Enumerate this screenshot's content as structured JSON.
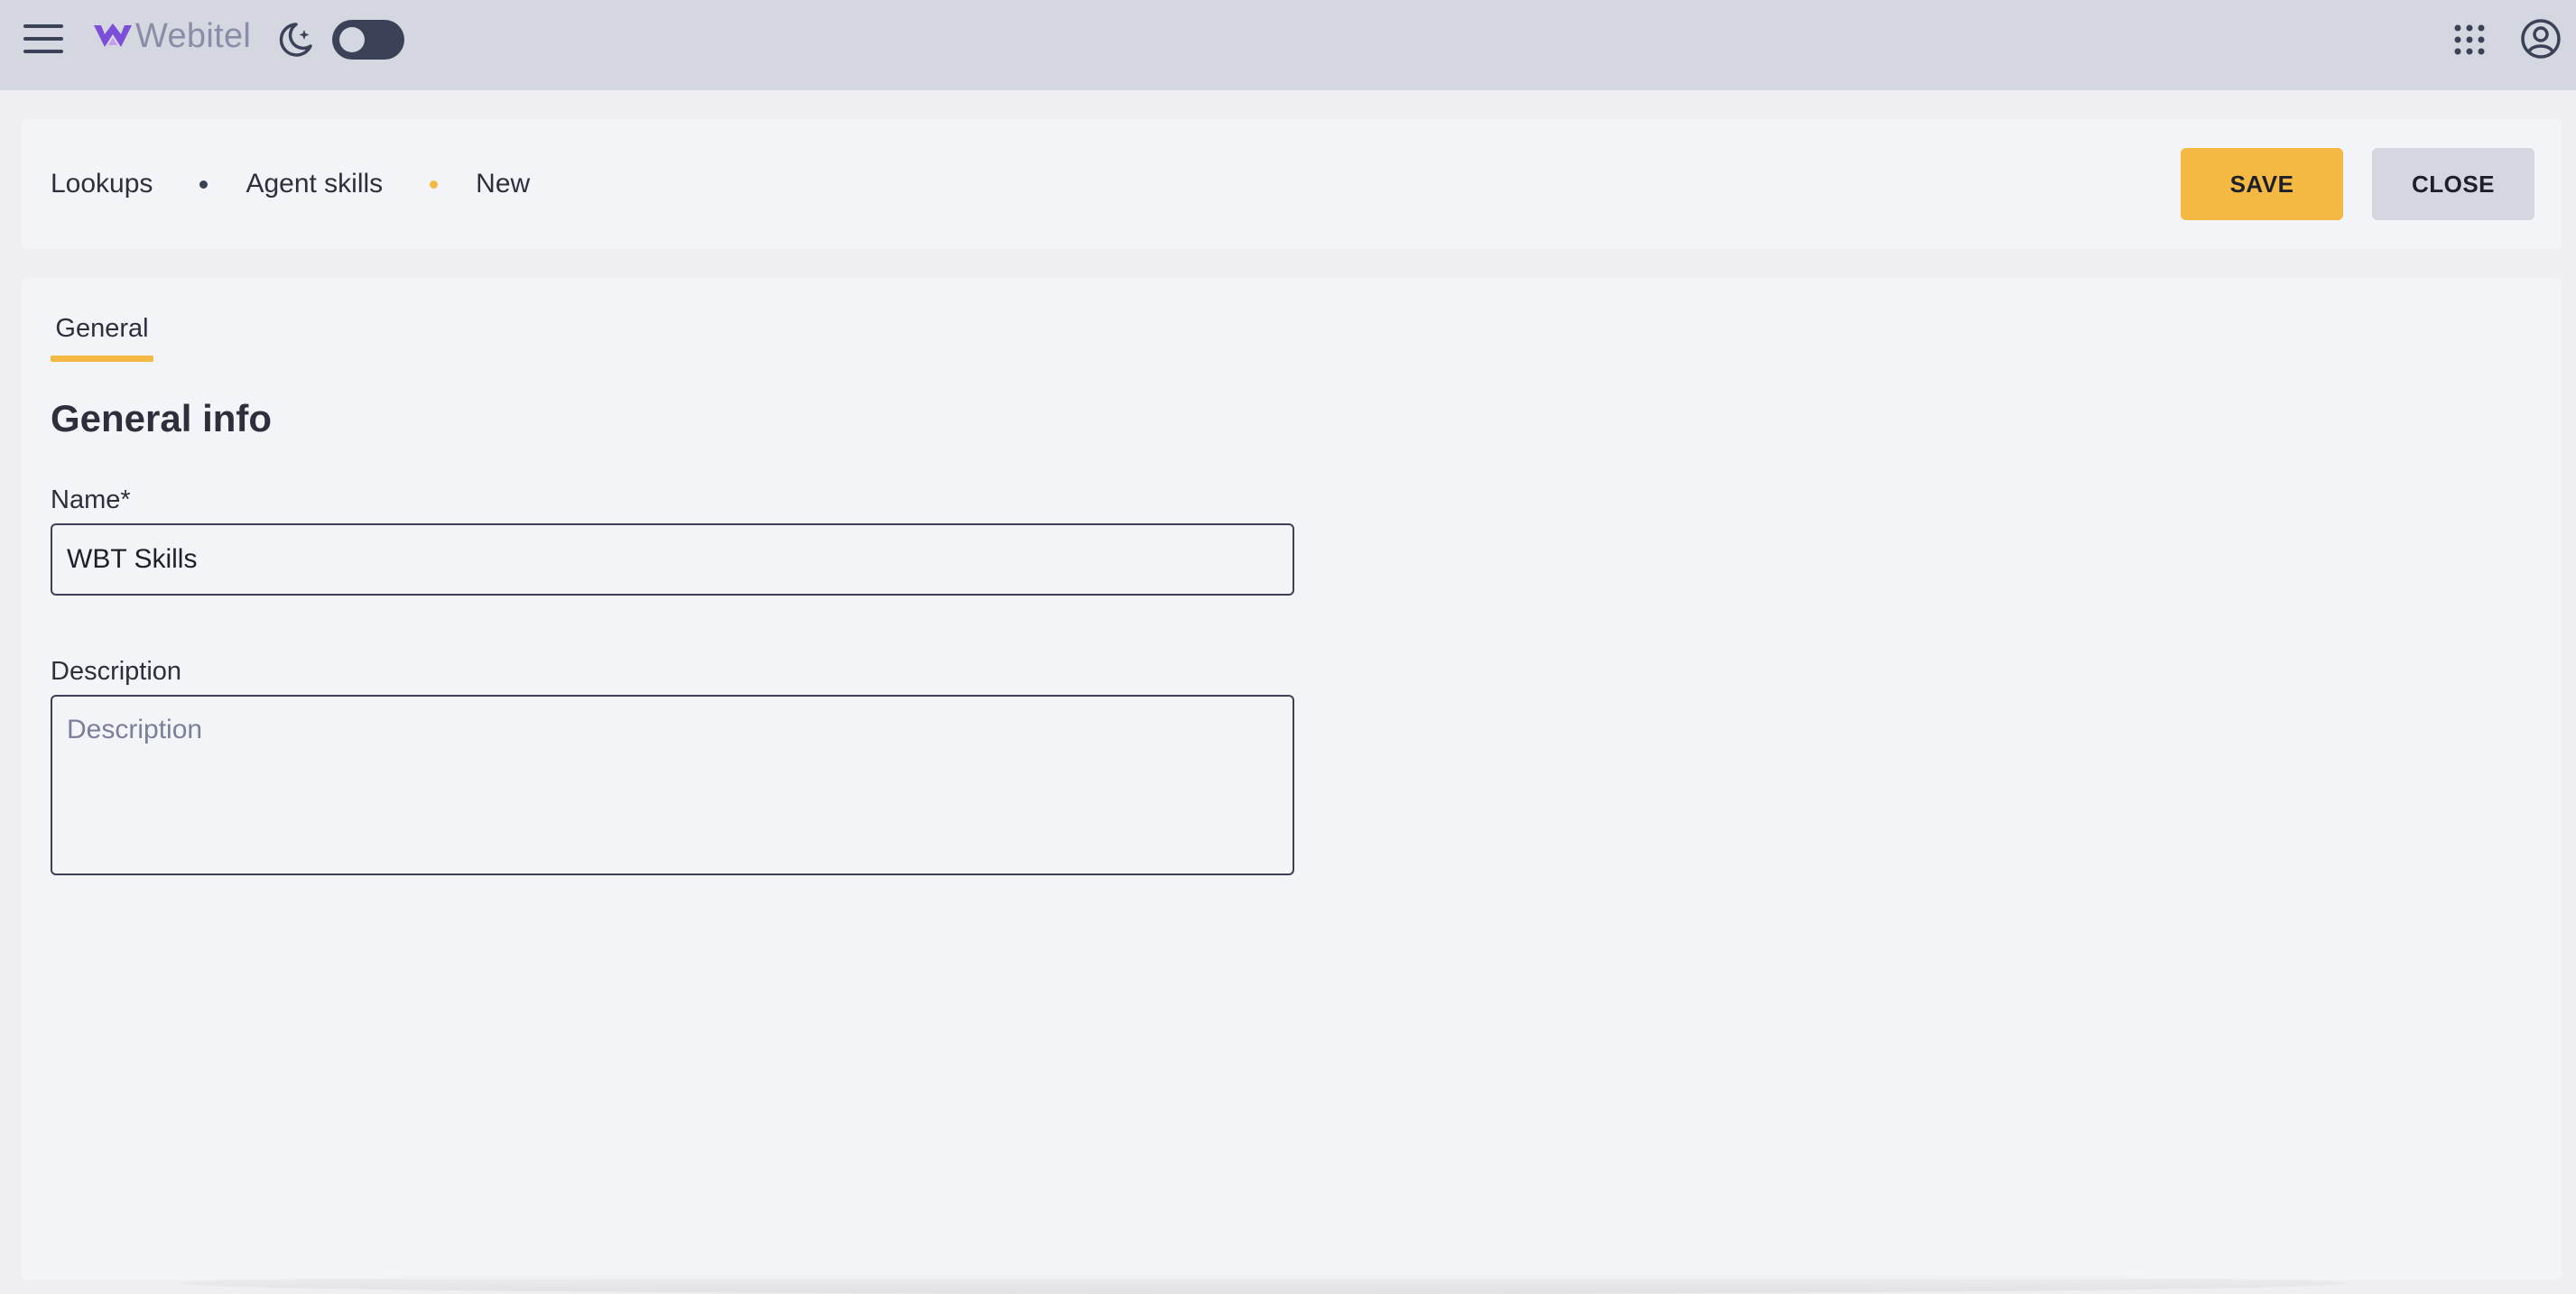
{
  "topbar": {
    "logo_text": "Webitel",
    "icons": {
      "menu": "hamburger-menu-icon",
      "theme": "moon-stars-icon",
      "apps": "apps-grid-icon",
      "account": "user-circle-icon"
    },
    "theme_toggle_on": false
  },
  "breadcrumb": {
    "items": [
      "Lookups",
      "Agent skills",
      "New"
    ],
    "active_dot_color": "#f4b942"
  },
  "actions": {
    "save_label": "SAVE",
    "close_label": "CLOSE"
  },
  "tabs": [
    {
      "label": "General",
      "active": true
    }
  ],
  "form": {
    "section_title": "General info",
    "name": {
      "label": "Name*",
      "value": "WBT Skills"
    },
    "description": {
      "label": "Description",
      "placeholder": "Description",
      "value": ""
    }
  },
  "colors": {
    "accent": "#f4b942",
    "topbar": "#d4d6e0",
    "toggle": "#3b4257"
  }
}
